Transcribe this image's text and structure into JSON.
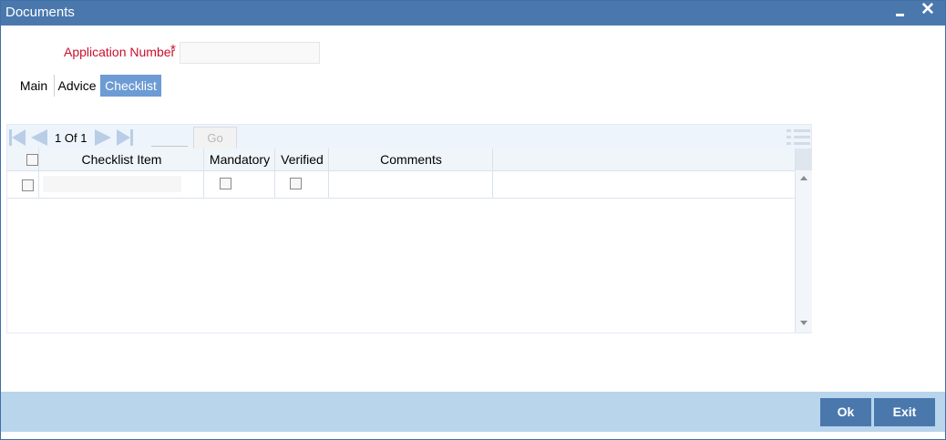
{
  "window": {
    "title": "Documents",
    "minimize_icon": "minimize-icon",
    "close_icon": "close-icon",
    "close_glyph": "✕"
  },
  "form": {
    "application_number_label": "Application Number",
    "required_marker": "*",
    "application_number_value": ""
  },
  "tabs": [
    {
      "label": "Main",
      "active": false
    },
    {
      "label": "Advice",
      "active": false
    },
    {
      "label": "Checklist",
      "active": true
    }
  ],
  "grid": {
    "pager": {
      "current_page": "1",
      "of_label": "Of",
      "total_pages": "1",
      "go_label": "Go",
      "goto_value": ""
    },
    "columns": [
      "Checklist Item",
      "Mandatory",
      "Verified",
      "Comments"
    ],
    "rows": [
      {
        "checklist_item": "",
        "mandatory": false,
        "verified": false,
        "comments": ""
      }
    ]
  },
  "footer": {
    "ok_label": "Ok",
    "exit_label": "Exit"
  },
  "colors": {
    "title_bar": "#4a78ad",
    "active_tab": "#6d9bd4",
    "footer": "#b9d5ec",
    "required": "#c8102e"
  }
}
